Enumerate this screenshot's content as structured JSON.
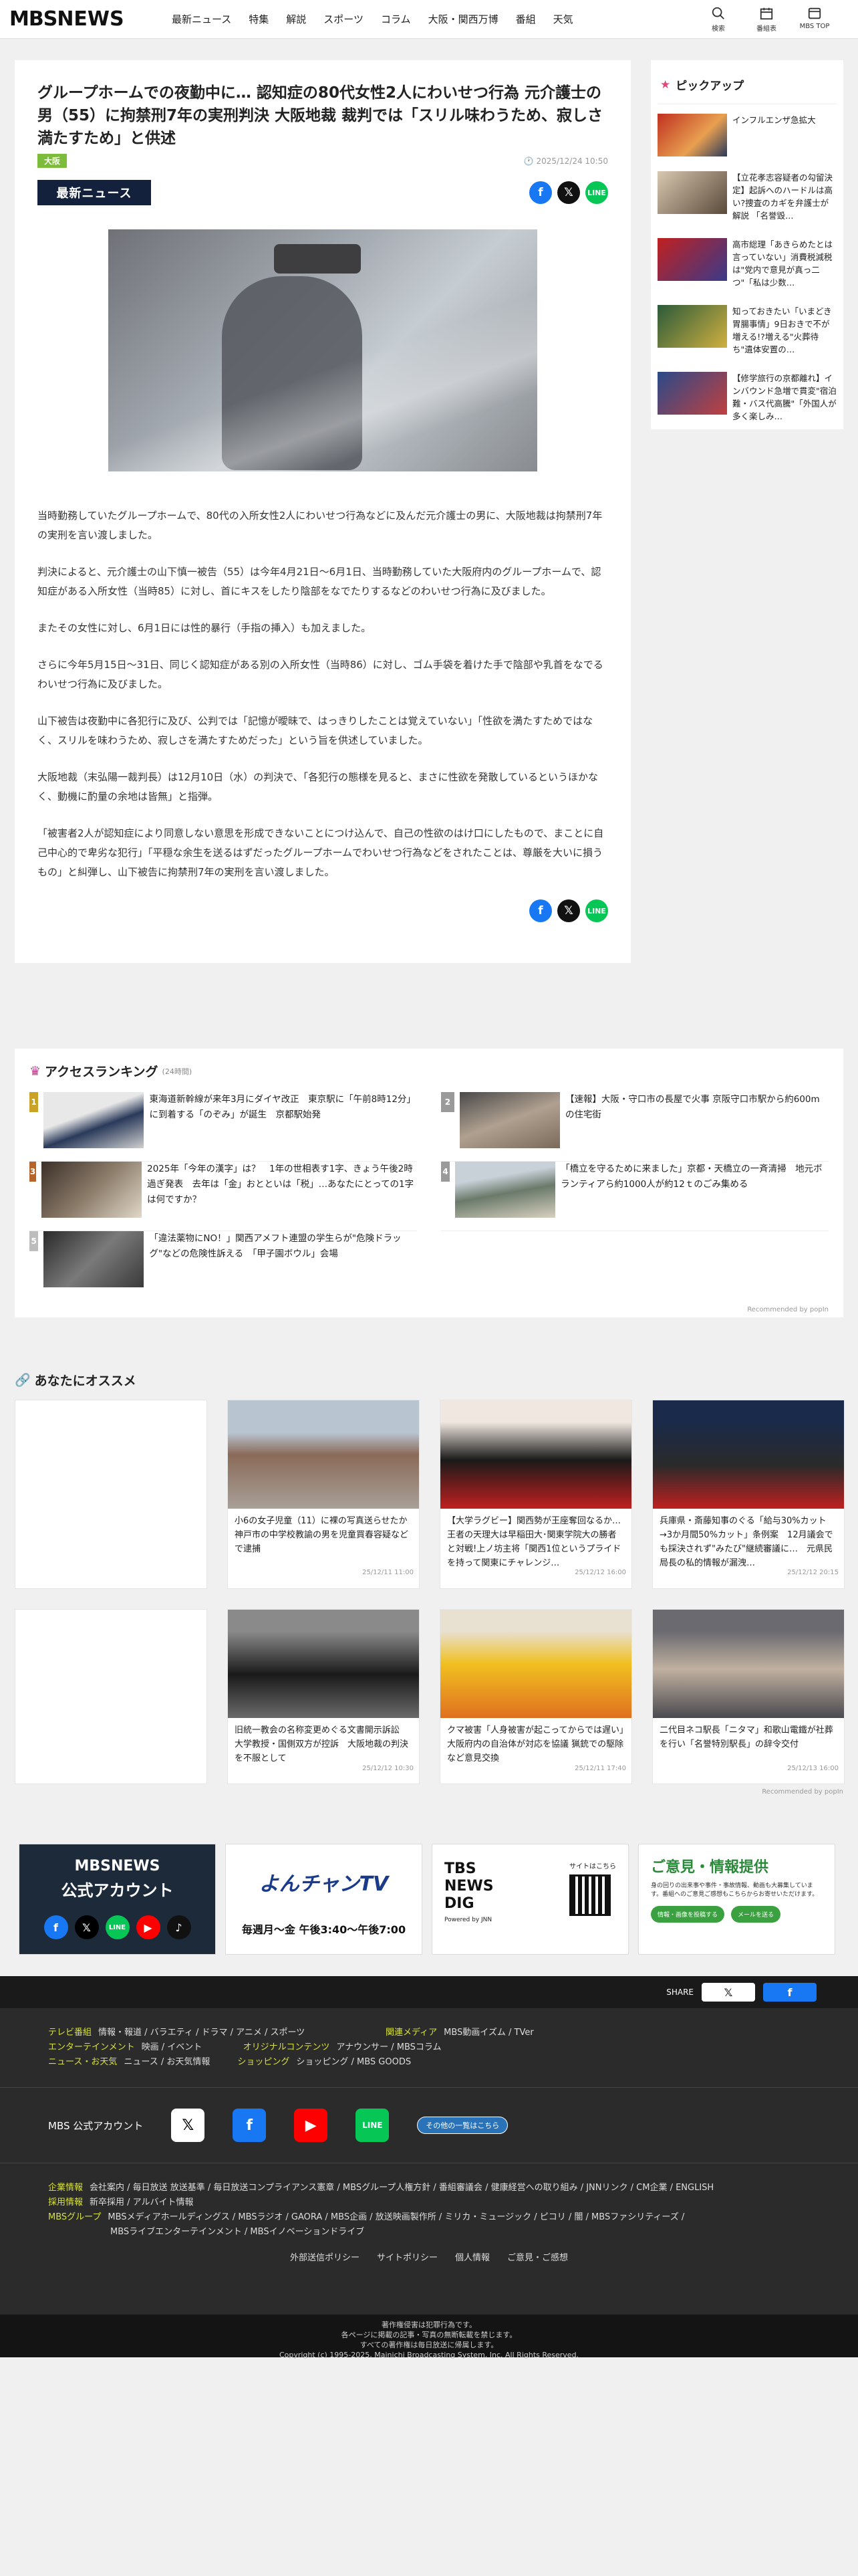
{
  "nav": {
    "logo_mbs": "MBS",
    "logo_news": "NEWS",
    "links": [
      "最新ニュース",
      "特集",
      "解説",
      "スポーツ",
      "コラム",
      "大阪・関西万博",
      "番組",
      "天気"
    ],
    "right": [
      {
        "label": "検索",
        "icon": "search-icon"
      },
      {
        "label": "番組表",
        "icon": "calendar-icon"
      },
      {
        "label": "MBS TOP",
        "icon": "home-icon"
      }
    ]
  },
  "article": {
    "title": "グループホームでの夜勤中に… 認知症の80代女性2人にわいせつ行為 元介護士の男（55）に拘禁刑7年の実刑判決 大阪地裁 裁判では「スリル味わうため、寂しさ満たすため」と供述",
    "tag": "大阪",
    "date": "2025/12/24 10:50",
    "category": "最新ニュース",
    "paragraphs": [
      "当時勤務していたグループホームで、80代の入所女性2人にわいせつ行為などに及んだ元介護士の男に、大阪地裁は拘禁刑7年の実刑を言い渡しました。",
      "判決によると、元介護士の山下慎一被告（55）は今年4月21日～6月1日、当時勤務していた大阪府内のグループホームで、認知症がある入所女性（当時85）に対し、首にキスをしたり陰部をなでたりするなどのわいせつ行為に及びました。",
      "またその女性に対し、6月1日には性的暴行（手指の挿入）も加えました。",
      "さらに今年5月15日～31日、同じく認知症がある別の入所女性（当時86）に対し、ゴム手袋を着けた手で陰部や乳首をなでるわいせつ行為に及びました。",
      "山下被告は夜勤中に各犯行に及び、公判では「記憶が曖昧で、はっきりしたことは覚えていない」「性欲を満たすためではなく、スリルを味わうため、寂しさを満たすためだった」という旨を供述していました。",
      "大阪地裁（末弘陽一裁判長）は12月10日（水）の判決で、「各犯行の態様を見ると、まさに性欲を発散しているというほかなく、動機に酌量の余地は皆無」と指弾。",
      "「被害者2人が認知症により同意しない意思を形成できないことにつけ込んで、自己の性欲のはけ口にしたもので、まことに自己中心的で卑劣な犯行」「平穏な余生を送るはずだったグループホームでわいせつ行為などをされたことは、尊厳を大いに損うもの」と糾弾し、山下被告に拘禁刑7年の実刑を言い渡しました。"
    ]
  },
  "pickup": {
    "title": "ピックアップ",
    "items": [
      "インフルエンザ急拡大",
      "【立花孝志容疑者の勾留決定】起訴へのハードルは高い?捜査のカギを弁護士が解説 「名誉毀…",
      "高市総理「あきらめたとは言っていない」消費税減税は\"党内で意見が真っ二つ\"「私は少数…",
      "知っておきたい「いまどき胃腸事情」9日おきで不が増える!?増える\"火葬待ち\"遺体安置の…",
      "【修学旅行の京都離れ】インバウンド急増で貫変\"宿泊難・バス代高騰\"「外国人が多く楽しみ…"
    ]
  },
  "ranking": {
    "title": "アクセスランキング",
    "sub": "(24時間)",
    "items": [
      {
        "rank": "1",
        "text": "東海道新幹線が来年3月にダイヤ改正　東京駅に「午前8時12分」に到着する「のぞみ」が誕生　京都駅始発"
      },
      {
        "rank": "2",
        "text": "【速報】大阪・守口市の長屋で火事 京阪守口市駅から約600mの住宅街"
      },
      {
        "rank": "3",
        "text": "2025年「今年の漢字」は？　1年の世相表す1字、きょう午後2時過ぎ発表　去年は「金」おとといは「税」…あなたにとっての1字は何ですか？"
      },
      {
        "rank": "4",
        "text": "「橋立を守るために来ました」京都・天橋立の一斉清掃　地元ボランティアら約1000人が約12ｔのごみ集める"
      },
      {
        "rank": "5",
        "text": "「違法薬物にNO！」関西アメフト連盟の学生らが\"危険ドラッグ\"などの危険性訴える　「甲子園ボウル」会場"
      }
    ],
    "recommended_by": "Recommended by popIn"
  },
  "osusume": {
    "title": "あなたにオススメ",
    "cards": [
      {
        "text": "",
        "date": ""
      },
      {
        "text": "小6の女子児童（11）に裸の写真送らせたか　神戸市の中学校教諭の男を児童買春容疑などで逮捕",
        "date": "25/12/11 11:00"
      },
      {
        "text": "【大学ラグビー】関西勢が王座奪回なるか…王者の天理大は早稲田大･関東学院大の勝者と対戦!上ノ坊主将「関西1位というプライドを持って関東にチャレンジ…",
        "date": "25/12/12 16:00"
      },
      {
        "text": "兵庫県・斎藤知事のぐる「給与30%カット→3か月間50%カット」条例案　12月議会でも採決されず\"みたび\"継続審議に…　元県民局長の私的情報が漏洩…",
        "date": "25/12/12 20:15"
      },
      {
        "text": "",
        "date": ""
      },
      {
        "text": "旧統一教会の名称変更めぐる文書開示訴訟　大学教授・国側双方が控訴　大阪地裁の判決を不服として",
        "date": "25/12/12 10:30"
      },
      {
        "text": "クマ被害「人身被害が起こってからでは遅い」大阪府内の自治体が対応を協議 猟銃での駆除など意見交換",
        "date": "25/12/11 17:40"
      },
      {
        "text": "二代目ネコ駅長「ニタマ」和歌山電鐵が社葬を行い「名誉特別駅長」の辞令交付",
        "date": "25/12/13 16:00"
      }
    ],
    "recommended_by": "Recommended by popIn"
  },
  "banners": [
    {
      "title": "MBSNEWS",
      "sub": "公式アカウント"
    },
    {
      "title": "よんチャンTV",
      "sub": "毎週月～金 午後3:40～午後7:00"
    },
    {
      "title": "TBS NEWS DIG",
      "sub": "Powered by JNN",
      "extra": "サイトはこちら"
    },
    {
      "title": "ご意見・情報提供",
      "sub": "身の回りの出来事や事件・事故情報、動画も大募集しています。番組へのご意見ご感想もこちらからお寄せいただけます。",
      "btn1": "情報・画像を投稿する",
      "btn2": "メールを送る"
    }
  ],
  "sharebar": {
    "label": "SHARE"
  },
  "footer": {
    "rows1": [
      {
        "key": "テレビ番組",
        "items": "情報・報道 / バラエティ / ドラマ / アニメ / スポーツ",
        "key2": "関連メディア",
        "items2": "MBS動画イズム / TVer"
      },
      {
        "key": "エンターテインメント",
        "items": "映画 / イベント",
        "key2": "オリジナルコンテンツ",
        "items2": "アナウンサー / MBSコラム"
      },
      {
        "key": "ニュース・お天気",
        "items": "ニュース / お天気情報",
        "key2": "ショッピング",
        "items2": "ショッピング / MBS GOODS"
      }
    ],
    "account_label": "MBS 公式アカウント",
    "account_all": "その他の一覧はこちら",
    "rows2": [
      {
        "key": "企業情報",
        "items": "会社案内 / 毎日放送 放送基準 / 毎日放送コンプライアンス憲章 / MBSグループ人権方針 / 番組審議会 / 健康経営への取り組み / JNNリンク / CM企業 / ENGLISH"
      },
      {
        "key": "採用情報",
        "items": "新卒採用 / アルバイト情報"
      },
      {
        "key": "MBSグループ",
        "items": "MBSメディアホールディングス / MBSラジオ / GAORA / MBS企画 / 放送映画製作所 / ミリカ・ミュージック / ピコリ / 闇 / MBSファシリティーズ /"
      },
      {
        "key": "",
        "items": "MBSライブエンターテインメント / MBSイノベーションドライブ"
      }
    ],
    "bottom_links": "外部送信ポリシー　　サイトポリシー　　個人情報　　ご意見・ご感想",
    "copyright1": "著作権侵害は犯罪行為です。",
    "copyright2": "各ページに掲載の記事・写真の無断転載を禁じます。",
    "copyright3": "すべての著作権は毎日放送に帰属します。",
    "copyright4": "Copyright (c) 1995-2025, Mainichi Broadcasting System, Inc. All Rights Reserved."
  }
}
